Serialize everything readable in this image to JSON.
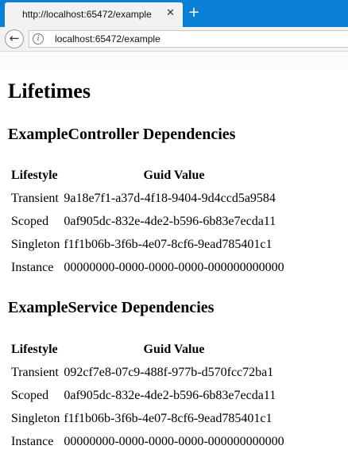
{
  "browser": {
    "tab_title": "http://localhost:65472/example",
    "close_glyph": "✕",
    "new_tab_glyph": "+",
    "back_glyph": "←",
    "info_glyph": "i",
    "url": "localhost:65472/example"
  },
  "page": {
    "title": "Lifetimes",
    "sections": [
      {
        "heading": "ExampleController Dependencies",
        "columns": [
          "Lifestyle",
          "Guid Value"
        ],
        "rows": [
          {
            "lifestyle": "Transient",
            "guid": "9a18e7f1-a37d-4f18-9404-9d4ccd5a9584"
          },
          {
            "lifestyle": "Scoped",
            "guid": "0af905dc-832e-4de2-b596-6b83e7ecda11"
          },
          {
            "lifestyle": "Singleton",
            "guid": "f1f1b06b-3f6b-4e07-8cf6-9ead785401c1"
          },
          {
            "lifestyle": "Instance",
            "guid": "00000000-0000-0000-0000-000000000000"
          }
        ]
      },
      {
        "heading": "ExampleService Dependencies",
        "columns": [
          "Lifestyle",
          "Guid Value"
        ],
        "rows": [
          {
            "lifestyle": "Transient",
            "guid": "092cf7e8-07c9-488f-977b-d570fcc72ba1"
          },
          {
            "lifestyle": "Scoped",
            "guid": "0af905dc-832e-4de2-b596-6b83e7ecda11"
          },
          {
            "lifestyle": "Singleton",
            "guid": "f1f1b06b-3f6b-4e07-8cf6-9ead785401c1"
          },
          {
            "lifestyle": "Instance",
            "guid": "00000000-0000-0000-0000-000000000000"
          }
        ]
      }
    ]
  }
}
